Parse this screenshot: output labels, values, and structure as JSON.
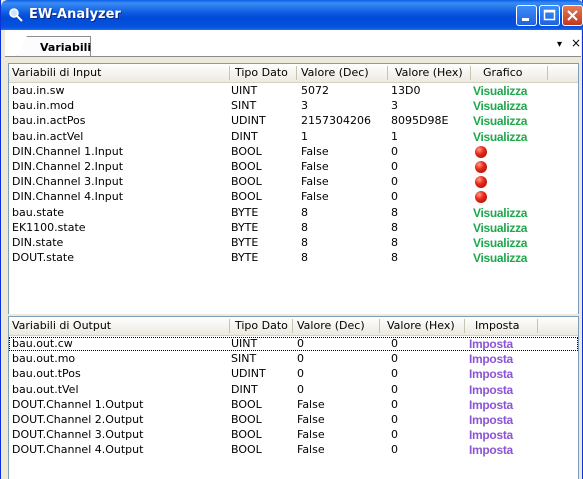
{
  "window": {
    "title": "EW-Analyzer"
  },
  "tab": {
    "label": "Variabili",
    "arrow": "▾",
    "close": "×"
  },
  "input_table": {
    "headers": {
      "name": "Variabili di Input",
      "type": "Tipo Dato",
      "dec": "Valore (Dec)",
      "hex": "Valore (Hex)",
      "graph": "Grafico"
    },
    "rows": [
      {
        "name": "bau.in.sw",
        "type": "UINT",
        "dec": "5072",
        "hex": "13D0",
        "graph": "Visualizza"
      },
      {
        "name": "bau.in.mod",
        "type": "SINT",
        "dec": "3",
        "hex": "3",
        "graph": "Visualizza"
      },
      {
        "name": "bau.in.actPos",
        "type": "UDINT",
        "dec": "2157304206",
        "hex": "8095D98E",
        "graph": "Visualizza"
      },
      {
        "name": "bau.in.actVel",
        "type": "DINT",
        "dec": "1",
        "hex": "1",
        "graph": "Visualizza"
      },
      {
        "name": "DIN.Channel 1.Input",
        "type": "BOOL",
        "dec": "False",
        "hex": "0",
        "graph": ""
      },
      {
        "name": "DIN.Channel 2.Input",
        "type": "BOOL",
        "dec": "False",
        "hex": "0",
        "graph": ""
      },
      {
        "name": "DIN.Channel 3.Input",
        "type": "BOOL",
        "dec": "False",
        "hex": "0",
        "graph": ""
      },
      {
        "name": "DIN.Channel 4.Input",
        "type": "BOOL",
        "dec": "False",
        "hex": "0",
        "graph": ""
      },
      {
        "name": "bau.state",
        "type": "BYTE",
        "dec": "8",
        "hex": "8",
        "graph": "Visualizza"
      },
      {
        "name": "EK1100.state",
        "type": "BYTE",
        "dec": "8",
        "hex": "8",
        "graph": "Visualizza"
      },
      {
        "name": "DIN.state",
        "type": "BYTE",
        "dec": "8",
        "hex": "8",
        "graph": "Visualizza"
      },
      {
        "name": "DOUT.state",
        "type": "BYTE",
        "dec": "8",
        "hex": "8",
        "graph": "Visualizza"
      }
    ]
  },
  "output_table": {
    "headers": {
      "name": "Variabili di Output",
      "type": "Tipo Dato",
      "dec": "Valore (Dec)",
      "hex": "Valore (Hex)",
      "set": "Imposta"
    },
    "rows": [
      {
        "name": "bau.out.cw",
        "type": "UINT",
        "dec": "0",
        "hex": "0",
        "set": "Imposta"
      },
      {
        "name": "bau.out.mo",
        "type": "SINT",
        "dec": "0",
        "hex": "0",
        "set": "Imposta"
      },
      {
        "name": "bau.out.tPos",
        "type": "UDINT",
        "dec": "0",
        "hex": "0",
        "set": "Imposta"
      },
      {
        "name": "bau.out.tVel",
        "type": "DINT",
        "dec": "0",
        "hex": "0",
        "set": "Imposta"
      },
      {
        "name": "DOUT.Channel 1.Output",
        "type": "BOOL",
        "dec": "False",
        "hex": "0",
        "set": "Imposta"
      },
      {
        "name": "DOUT.Channel 2.Output",
        "type": "BOOL",
        "dec": "False",
        "hex": "0",
        "set": "Imposta"
      },
      {
        "name": "DOUT.Channel 3.Output",
        "type": "BOOL",
        "dec": "False",
        "hex": "0",
        "set": "Imposta"
      },
      {
        "name": "DOUT.Channel 4.Output",
        "type": "BOOL",
        "dec": "False",
        "hex": "0",
        "set": "Imposta"
      }
    ]
  },
  "colors": {
    "link_green": "#1fa84c",
    "link_purple": "#8b55d6",
    "led_red": "#e8291b",
    "title_blue": "#0249d8"
  }
}
